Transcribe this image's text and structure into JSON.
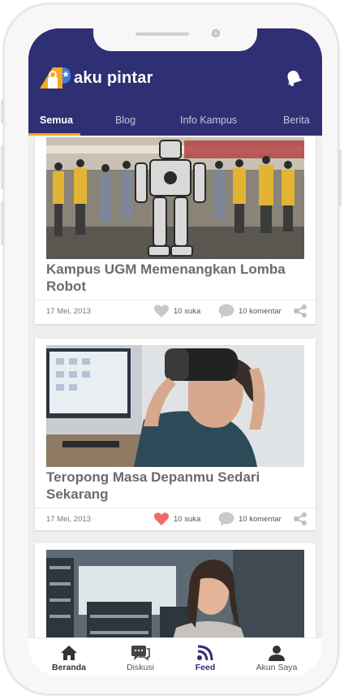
{
  "app": {
    "name": "aku pintar"
  },
  "tabs": [
    {
      "label": "Semua",
      "active": true
    },
    {
      "label": "Blog",
      "active": false
    },
    {
      "label": "Info Kampus",
      "active": false
    },
    {
      "label": "Berita",
      "active": false
    }
  ],
  "posts": [
    {
      "title": "Kampus UGM Memenangkan Lomba Robot",
      "date": "17 Mei, 2013",
      "likes": "10 suka",
      "liked": false,
      "comments": "10 komentar",
      "image": "robot-competition-photo"
    },
    {
      "title": "Teropong Masa Depanmu Sedari Sekarang",
      "date": "17 Mei, 2013",
      "likes": "10 suka",
      "liked": true,
      "comments": "10 komentar",
      "image": "vr-headset-photo"
    },
    {
      "title": "",
      "image": "library-student-photo"
    }
  ],
  "bottom_nav": [
    {
      "label": "Beranda",
      "icon": "home-icon"
    },
    {
      "label": "Diskusi",
      "icon": "chat-icon"
    },
    {
      "label": "Feed",
      "icon": "rss-icon",
      "active": true
    },
    {
      "label": "Akun Saya",
      "icon": "user-icon"
    }
  ],
  "colors": {
    "header": "#2f2f74",
    "accent": "#f3a826",
    "like_active": "#f06a6a",
    "text_title": "#6b6b6b"
  }
}
